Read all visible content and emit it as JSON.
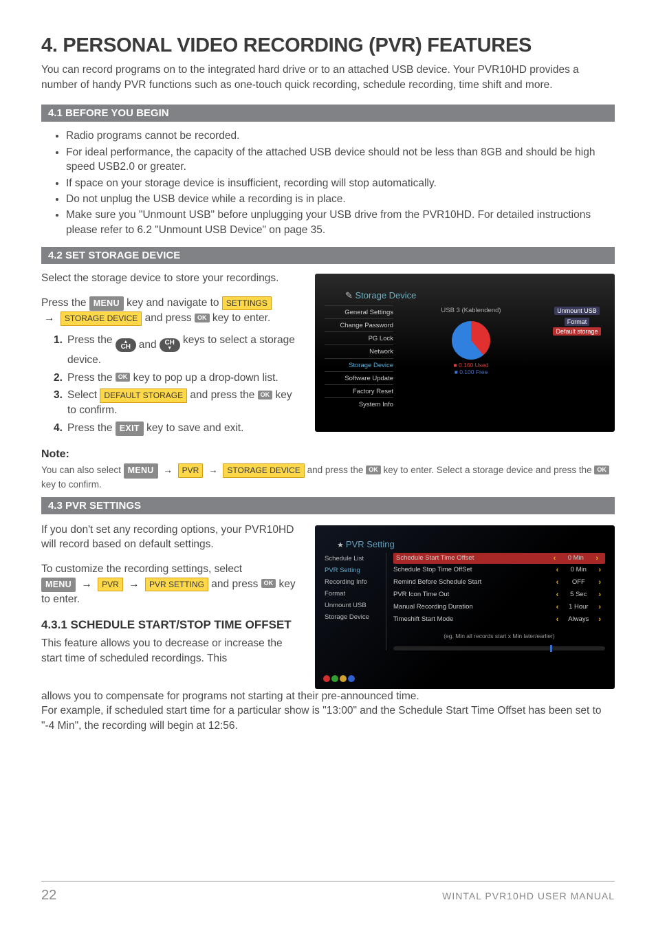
{
  "title": "4. PERSONAL VIDEO RECORDING (PVR) FEATURES",
  "intro": "You can record programs on to the integrated hard drive or to an attached USB device. Your PVR10HD provides a number of handy PVR functions such as one-touch quick recording, schedule recording, time shift and more.",
  "section41": {
    "heading": "4.1 BEFORE YOU BEGIN",
    "bullets": [
      "Radio programs cannot be recorded.",
      "For ideal performance, the capacity of the attached USB device should not be less than 8GB and should be high speed USB2.0 or greater.",
      "If space on your storage device is insufficient, recording will stop automatically.",
      "Do not unplug the USB device while a recording is in place.",
      "Make sure you \"Unmount USB\" before unplugging your USB drive from the PVR10HD. For detailed instructions please refer to 6.2 \"Unmount USB Device\" on page 35."
    ]
  },
  "section42": {
    "heading": "4.2 SET STORAGE DEVICE",
    "lead": "Select the storage device to store your recordings.",
    "press_prefix": "Press the",
    "menu_key": "MENU",
    "press_mid": "key and navigate to",
    "settings_label": "SETTINGS",
    "storage_device_label": "STORAGE DEVICE",
    "and_press": "and press",
    "ok_label": "OK",
    "key_to_enter": "key to enter.",
    "steps": [
      {
        "n": "1.",
        "pre": "Press the",
        "post": "keys to select a storage device."
      },
      {
        "n": "2.",
        "pre": "Press the",
        "post": "key to pop up a drop-down list."
      },
      {
        "n": "3.",
        "pre": "Select",
        "mid": "DEFAULT STORAGE",
        "mid2": "and press the",
        "post": "key to confirm."
      },
      {
        "n": "4.",
        "pre": "Press the",
        "mid": "EXIT",
        "post": "key to save and exit."
      }
    ],
    "and_label": "and",
    "ch_label": "CH",
    "note_heading": "Note:",
    "note_1": "You can also select",
    "note_pvr": "PVR",
    "note_storage": "STORAGE DEVICE",
    "note_mid": "and press the",
    "note_2": "key to enter. Select a storage device and press the",
    "note_3": "key to confirm.",
    "mock": {
      "title": "Storage Device",
      "left_menu": [
        "General Settings",
        "Change Password",
        "PG Lock",
        "Network",
        "Storage Device",
        "Software Update",
        "Factory Reset",
        "System Info"
      ],
      "col2_label": "USB 3 (Kablendend)",
      "right_items": [
        "Unmount USB",
        "Format",
        "Default storage"
      ],
      "pie_labels": [
        "0.160 Used",
        "0.100 Free"
      ]
    }
  },
  "section43": {
    "heading": "4.3 PVR SETTINGS",
    "p1": "If you don't set any recording options, your PVR10HD will record based on default settings.",
    "p2_pre": "To customize the recording settings, select",
    "pvr_setting_label": "PVR SETTING",
    "p2_post": "and press",
    "p2_tail": "key to enter.",
    "sub_heading": "4.3.1 SCHEDULE START/STOP TIME OFFSET",
    "sub_body": [
      "This feature allows you to decrease or increase the start time of scheduled recordings. This allows you to compensate for programs not starting at their pre-announced time.",
      "For example, if scheduled start time for a particular show is \"13:00\" and the Schedule Start Time Offset has been set to \"-4 Min\", the recording will begin at 12:56."
    ],
    "mock2": {
      "title": "PVR Setting",
      "left_menu": [
        "Schedule List",
        "PVR Setting",
        "Recording Info",
        "Format",
        "Unmount USB",
        "Storage Device"
      ],
      "rows": [
        {
          "label": "Schedule Start Time Offset",
          "value": "0 Min",
          "highlight": true
        },
        {
          "label": "Schedule Stop Time OffSet",
          "value": "0 Min"
        },
        {
          "label": "Remind Before Schedule Start",
          "value": "OFF"
        },
        {
          "label": "PVR Icon Time Out",
          "value": "5 Sec"
        },
        {
          "label": "Manual Recording Duration",
          "value": "1 Hour"
        },
        {
          "label": "Timeshift Start Mode",
          "value": "Always"
        }
      ],
      "footnote": "(eg. Min all records start x Min later/earlier)"
    }
  },
  "footer": {
    "page": "22",
    "manual": "WINTAL PVR10HD USER MANUAL"
  }
}
